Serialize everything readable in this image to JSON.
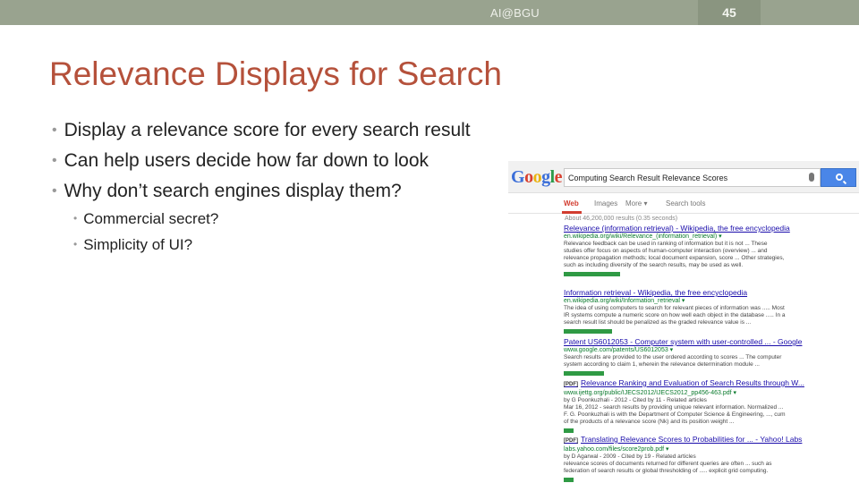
{
  "header": {
    "text": "AI@BGU",
    "slide_number": "45"
  },
  "title": "Relevance Displays for Search",
  "bullets": [
    "Display a relevance score for every search result",
    "Can help users decide how far down to look",
    "Why don’t search engines display them?"
  ],
  "sub_bullets": [
    "Commercial secret?",
    "Simplicity of UI?"
  ],
  "google": {
    "logo_letters": [
      "G",
      "o",
      "o",
      "g",
      "l",
      "e"
    ],
    "search_value": "Computing Search Result Relevance Scores",
    "tabs": [
      "Web",
      "Images",
      "More ▾",
      "Search tools"
    ],
    "stats": "About 46,200,000 results (0.35 seconds)",
    "results": [
      {
        "tag": "",
        "title": "Relevance (information retrieval) - Wikipedia, the free encyclopedia",
        "url": "en.wikipedia.org/wiki/Relevance_(information_retrieval) ▾",
        "snippets": [
          "Relevance feedback can be used in ranking of information but it is not ... These",
          "studies offer focus on aspects of human-computer interaction (overview) ... and",
          "relevance propagation methods; local document expansion, score ... Other strategies,",
          "such as including diversity of the search results, may be used as well."
        ],
        "score": 0.42
      },
      {
        "tag": "",
        "title": "Information retrieval - Wikipedia, the free encyclopedia",
        "url": "en.wikipedia.org/wiki/Information_retrieval ▾",
        "snippets": [
          "The idea of using computers to search for relevant pieces of information was ..... Most",
          "IR systems compute a numeric score on how well each object in the database ..... In a",
          "search result list should be penalized as the graded relevance value is ..."
        ],
        "score": 0.36
      },
      {
        "tag": "",
        "title": "Patent US6012053 - Computer system with user-controlled ... - Google",
        "url": "www.google.com/patents/US6012053 ▾",
        "snippets": [
          "Search results are provided to the user ordered according to scores ... The computer",
          "system according to claim 1, wherein the relevance determination module ..."
        ],
        "score": 0.3
      },
      {
        "tag": "[PDF]",
        "title": "Relevance Ranking and Evaluation of Search Results through W...",
        "url": "www.ijettg.org/public/IJECS2012/IJECS2012_pp456-463.pdf ▾",
        "snippets": [
          "by G Poonkuzhali - 2012 - Cited by 11 - Related articles",
          "Mar 16, 2012 - search results by providing unique relevant information. Normalized ...",
          "F. G. Poonkuzhali is with the Department of Computer Science & Engineering, ..., cum",
          "of the products of a relevance score (Nk) and its position weight ..."
        ],
        "score": 0.07
      },
      {
        "tag": "[PDF]",
        "title": "Translating Relevance Scores to Probabilities for ... - Yahoo! Labs",
        "url": "labs.yahoo.com/files/score2prob.pdf ▾",
        "snippets": [
          "by D Agarwal - 2009 - Cited by 19 - Related articles",
          "relevance scores of documents returned for different queries are often ... such as",
          "federation of search results or global thresholding of ..... explicit grid computing."
        ],
        "score": 0.07
      }
    ]
  }
}
